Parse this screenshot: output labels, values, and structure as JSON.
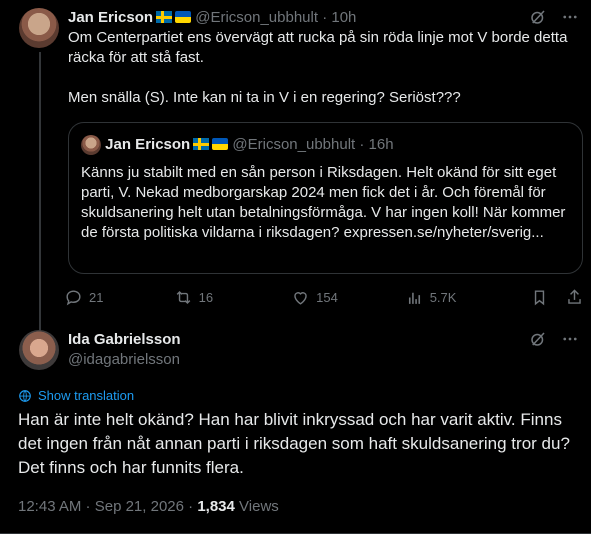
{
  "reply_to_tweet": {
    "author_name": "Jan Ericson",
    "author_handle": "@Ericson_ubbhult",
    "time": "10h",
    "paragraphs": [
      "Om Centerpartiet ens övervägt att rucka på sin röda linje mot V borde detta räcka för att stå fast.",
      "Men snälla (S). Inte kan ni ta in V i en regering? Seriöst???"
    ],
    "quoted": {
      "author_name": "Jan Ericson",
      "author_handle": "@Ericson_ubbhult",
      "time": "16h",
      "text": "Känns ju stabilt med en sån person i Riksdagen. Helt okänd för sitt eget parti, V. Nekad medborgarskap 2024 men fick det i år. Och föremål för skuldsanering helt utan betalningsförmåga. V har ingen koll! När kommer de första politiska vildarna i riksdagen?",
      "link": "expressen.se/nyheter/sverig..."
    },
    "actions": {
      "replies": "21",
      "reposts": "16",
      "likes": "154",
      "views": "5.7K"
    }
  },
  "main_tweet": {
    "author_name": "Ida Gabrielsson",
    "author_handle": "@idagabrielsson",
    "show_translation": "Show translation",
    "text": "Han är inte helt okänd? Han har blivit inkryssad och har varit aktiv. Finns det ingen från nåt annan parti i riksdagen som haft skuldsanering tror du? Det finns och har funnits flera.",
    "time": "12:43 AM",
    "date": "Sep 21, 2026",
    "views_count": "1,834",
    "views_label": "Views"
  },
  "colors": {
    "background": "#000000",
    "text": "#e7e9ea",
    "muted": "#71767b",
    "link": "#1d9bf0",
    "border": "#2f3336"
  }
}
